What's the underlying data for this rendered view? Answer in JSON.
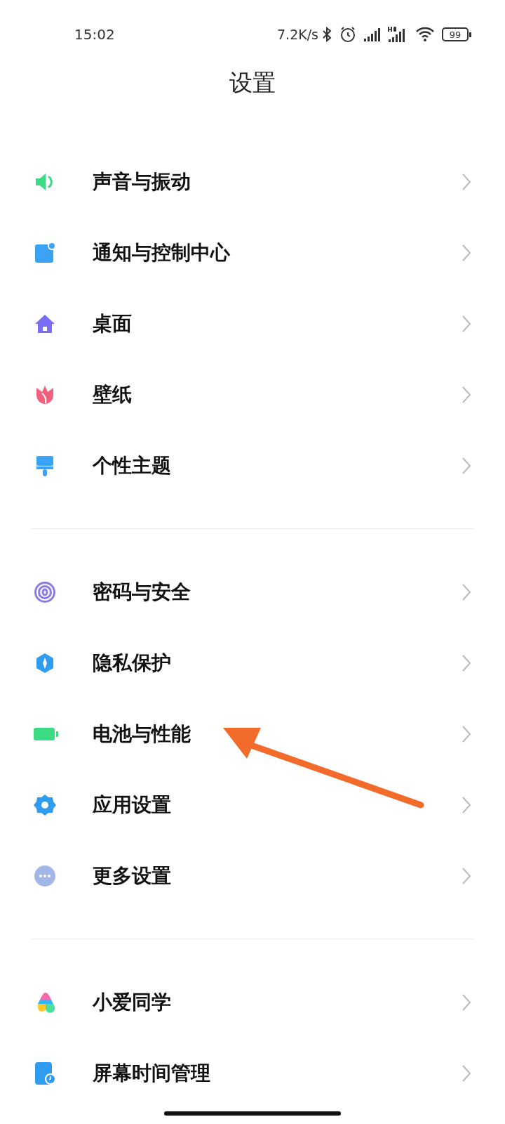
{
  "status_bar": {
    "time": "15:02",
    "net_speed": "7.2K/s",
    "battery": "99"
  },
  "title": "设置",
  "groups": [
    {
      "items": [
        {
          "label": "声音与振动",
          "kind": "sound"
        },
        {
          "label": "通知与控制中心",
          "kind": "notification"
        },
        {
          "label": "桌面",
          "kind": "home"
        },
        {
          "label": "壁纸",
          "kind": "tulip"
        },
        {
          "label": "个性主题",
          "kind": "brush"
        }
      ]
    },
    {
      "items": [
        {
          "label": "密码与安全",
          "kind": "fingerprint"
        },
        {
          "label": "隐私保护",
          "kind": "shield"
        },
        {
          "label": "电池与性能",
          "kind": "battery"
        },
        {
          "label": "应用设置",
          "kind": "gear"
        },
        {
          "label": "更多设置",
          "kind": "more"
        }
      ]
    },
    {
      "items": [
        {
          "label": "小爱同学",
          "kind": "assistant"
        },
        {
          "label": "屏幕时间管理",
          "kind": "screen-time"
        }
      ]
    }
  ]
}
